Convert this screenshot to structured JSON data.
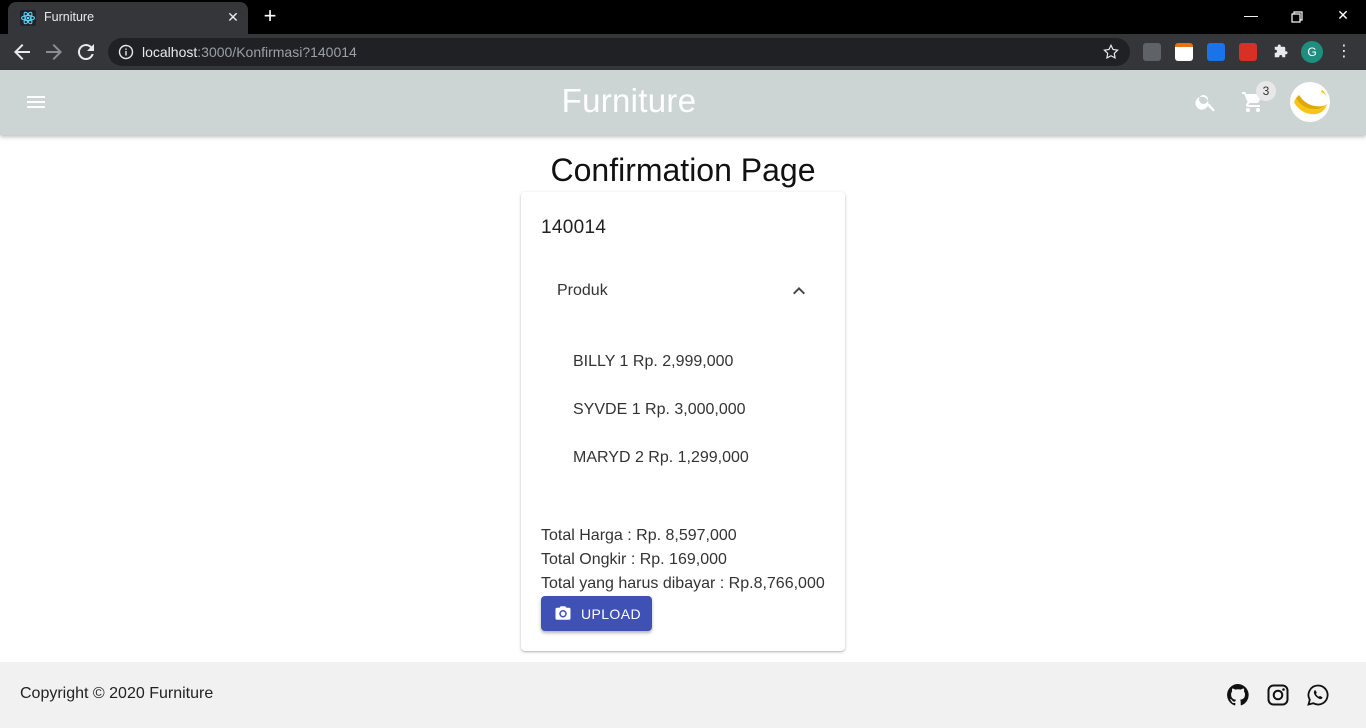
{
  "browser": {
    "tab_title": "Furniture",
    "url_host": "localhost",
    "url_path": ":3000/Konfirmasi?140014",
    "profile_initial": "G"
  },
  "appbar": {
    "brand": "Furniture",
    "cart_count": "3"
  },
  "page": {
    "title": "Confirmation Page"
  },
  "order": {
    "id": "140014",
    "section_label": "Produk",
    "products": [
      "BILLY 1 Rp. 2,999,000",
      "SYVDE 1 Rp. 3,000,000",
      "MARYD 2 Rp. 1,299,000"
    ],
    "total_price": "Total Harga : Rp. 8,597,000",
    "total_shipping": "Total Ongkir : Rp. 169,000",
    "total_due": "Total yang harus dibayar : Rp.8,766,000",
    "upload_label": "UPLOAD"
  },
  "footer": {
    "copyright": "Copyright © 2020 Furniture"
  },
  "colors": {
    "appbar_bg": "#cdd5d4",
    "primary": "#3f51b5",
    "footer_bg": "#f1f1f1"
  }
}
